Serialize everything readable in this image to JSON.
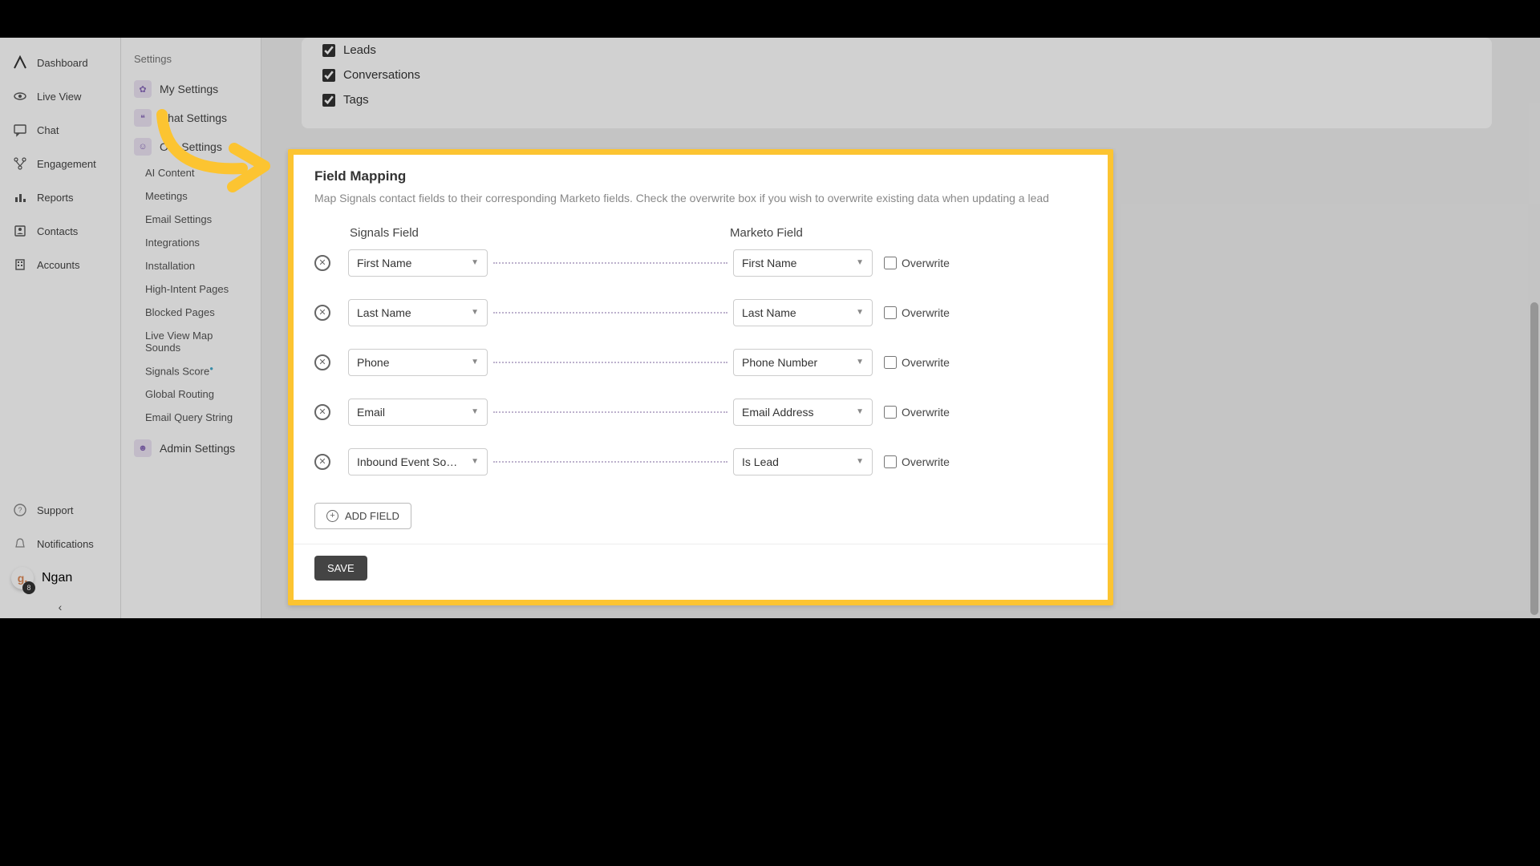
{
  "nav_primary": {
    "items": [
      {
        "label": "Dashboard",
        "icon": "logo"
      },
      {
        "label": "Live View",
        "icon": "eye"
      },
      {
        "label": "Chat",
        "icon": "chat"
      },
      {
        "label": "Engagement",
        "icon": "branch"
      },
      {
        "label": "Reports",
        "icon": "bars"
      },
      {
        "label": "Contacts",
        "icon": "person"
      },
      {
        "label": "Accounts",
        "icon": "building"
      }
    ],
    "footer": [
      {
        "label": "Support",
        "icon": "question"
      },
      {
        "label": "Notifications",
        "icon": "bell"
      }
    ],
    "user": {
      "name": "Ngan",
      "avatar_text": "g.",
      "badge": "8"
    }
  },
  "nav_secondary": {
    "header": "Settings",
    "groups": [
      {
        "label": "My Settings",
        "icon": "gear"
      },
      {
        "label": "Chat Settings",
        "icon": "chat"
      },
      {
        "label": "Org Settings",
        "icon": "people",
        "sub": [
          "AI Content",
          "Meetings",
          "Email Settings",
          "Integrations",
          "Installation",
          "High-Intent Pages",
          "Blocked Pages",
          "Live View Map Sounds",
          "Signals Score",
          "Global Routing",
          "Email Query String"
        ]
      },
      {
        "label": "Admin Settings",
        "icon": "admin"
      }
    ]
  },
  "top_card": {
    "checks": [
      {
        "label": "Leads",
        "checked": true
      },
      {
        "label": "Conversations",
        "checked": true
      },
      {
        "label": "Tags",
        "checked": true
      }
    ]
  },
  "mapping": {
    "title": "Field Mapping",
    "desc": "Map Signals contact fields to their corresponding Marketo fields. Check the overwrite box if you wish to overwrite existing data when updating a lead",
    "col1": "Signals Field",
    "col2": "Marketo Field",
    "rows": [
      {
        "signals": "First Name",
        "marketo": "First Name",
        "overwrite": false
      },
      {
        "signals": "Last Name",
        "marketo": "Last Name",
        "overwrite": false
      },
      {
        "signals": "Phone",
        "marketo": "Phone Number",
        "overwrite": false
      },
      {
        "signals": "Email",
        "marketo": "Email Address",
        "overwrite": false
      },
      {
        "signals": "Inbound Event So…",
        "marketo": "Is Lead",
        "overwrite": false
      }
    ],
    "overwrite_label": "Overwrite",
    "add_field": "ADD FIELD",
    "save": "SAVE"
  }
}
